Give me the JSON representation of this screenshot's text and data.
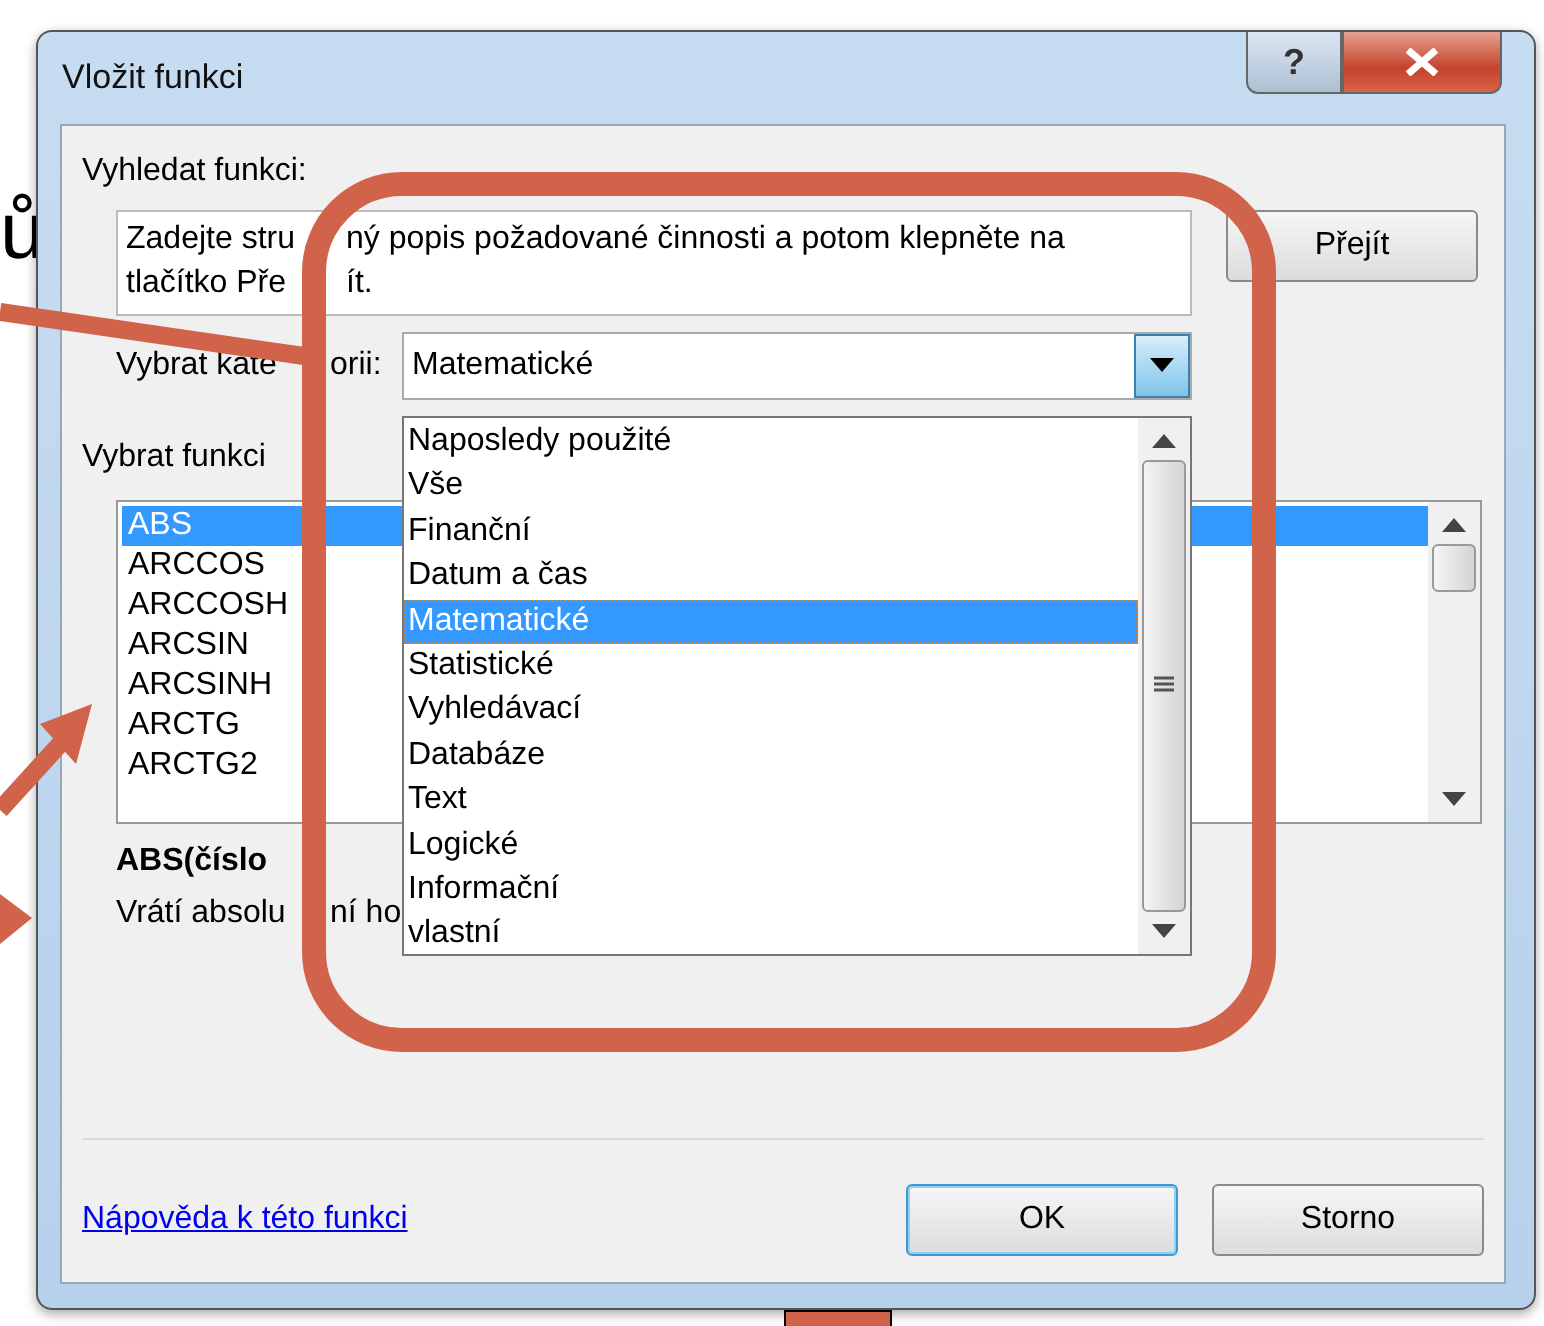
{
  "slide_text": "ů",
  "window": {
    "title": "Vložit funkci",
    "help_button": "?"
  },
  "search": {
    "label": "Vyhledat funkci:",
    "go_button": "Přejít",
    "lines": [
      {
        "left": "Zadejte stru",
        "right": "ný popis požadované činnosti a potom klepněte na"
      },
      {
        "left": "tlačítko Pře",
        "right": "ít."
      }
    ]
  },
  "category": {
    "label": {
      "left": "Vybrat kate",
      "right": "orii:"
    },
    "value": "Matematické",
    "expanded": true,
    "options": [
      {
        "label": "Naposledy použité",
        "selected": false
      },
      {
        "label": "Vše",
        "selected": false
      },
      {
        "label": "Finanční",
        "selected": false
      },
      {
        "label": "Datum a čas",
        "selected": false
      },
      {
        "label": "Matematické",
        "selected": true
      },
      {
        "label": "Statistické",
        "selected": false
      },
      {
        "label": "Vyhledávací",
        "selected": false
      },
      {
        "label": "Databáze",
        "selected": false
      },
      {
        "label": "Text",
        "selected": false
      },
      {
        "label": "Logické",
        "selected": false
      },
      {
        "label": "Informační",
        "selected": false
      },
      {
        "label": "vlastní",
        "selected": false
      }
    ]
  },
  "functions": {
    "label": "Vybrat funkci",
    "items": [
      {
        "label": "ABS",
        "selected": true
      },
      {
        "label": "ARCCOS",
        "selected": false
      },
      {
        "label": "ARCCOSH",
        "selected": false
      },
      {
        "label": "ARCSIN",
        "selected": false
      },
      {
        "label": "ARCSINH",
        "selected": false
      },
      {
        "label": "ARCTG",
        "selected": false
      },
      {
        "label": "ARCTG2",
        "selected": false
      }
    ]
  },
  "signature": "ABS(číslo",
  "description": {
    "left": "Vrátí absolu",
    "right": "ní ho"
  },
  "help_link": "Nápověda k této funkci",
  "buttons": [
    {
      "label": "OK",
      "default": true
    },
    {
      "label": "Storno",
      "default": false
    }
  ]
}
